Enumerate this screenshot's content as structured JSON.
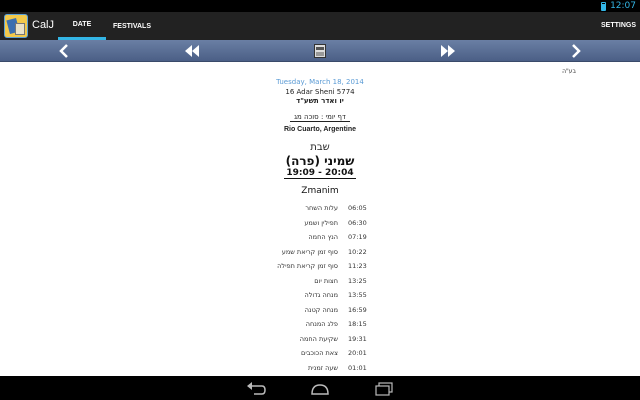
{
  "status": {
    "time": "12:07"
  },
  "app": {
    "title": "CalJ",
    "tabs": [
      "DATE",
      "FESTIVALS"
    ],
    "settings": "SETTINGS"
  },
  "corner_label": "בע\"ה",
  "date": {
    "gregorian": "Tuesday, March 18, 2014",
    "hebrew": "16 Adar Sheni 5774",
    "hebrew_he": "יו ואדר תשע\"ד"
  },
  "daf_yomi": "דף יומי : סוכה מג",
  "location": "Rio Cuarto, Argentine",
  "shabbat": "שבת",
  "parasha": "שמיני (פרה)",
  "candles": "19:09 - 20:04",
  "zmanim_title": "Zmanim",
  "zmanim": [
    {
      "name": "עלות השחר",
      "time": "06:05"
    },
    {
      "name": "תפילין ושמע",
      "time": "06:30"
    },
    {
      "name": "הנץ החמה",
      "time": "07:19"
    },
    {
      "name": "סוף זמן קריאת שמע",
      "time": "10:22"
    },
    {
      "name": "סוף זמן קריאת תפילה",
      "time": "11:23"
    },
    {
      "name": "חצות יום",
      "time": "13:25"
    },
    {
      "name": "מנחה גדולה",
      "time": "13:55"
    },
    {
      "name": "מנחה קטנה",
      "time": "16:59"
    },
    {
      "name": "פלג המנחה",
      "time": "18:15"
    },
    {
      "name": "שקיעת החמה",
      "time": "19:31"
    },
    {
      "name": "צאת הכוכבים",
      "time": "20:01"
    },
    {
      "name": "שעה זמנית",
      "time": "01:01"
    }
  ],
  "icons": {
    "nav": [
      "chevron-left-icon",
      "rewind-icon",
      "calendar-icon",
      "fast-forward-icon",
      "chevron-right-icon"
    ],
    "system": [
      "back-icon",
      "home-icon",
      "recent-apps-icon"
    ]
  },
  "colors": {
    "accent": "#33b5e5",
    "link_date": "#5b9bd5",
    "navbar": "#5a6e96"
  }
}
